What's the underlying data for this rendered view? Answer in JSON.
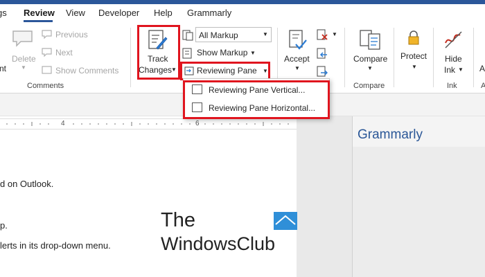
{
  "tabs": [
    {
      "label": "gs"
    },
    {
      "label": "Review"
    },
    {
      "label": "View"
    },
    {
      "label": "Developer"
    },
    {
      "label": "Help"
    },
    {
      "label": "Grammarly"
    }
  ],
  "comments_group": {
    "label": "Comments",
    "new_comment_fragment": "nt",
    "delete": "Delete",
    "previous": "Previous",
    "next": "Next",
    "show_comments": "Show Comments"
  },
  "tracking_group": {
    "track_changes_line1": "Track",
    "track_changes_line2": "Changes",
    "markup_select": "All Markup",
    "show_markup": "Show Markup",
    "reviewing_pane": "Reviewing Pane"
  },
  "changes_group": {
    "accept": "Accept"
  },
  "compare_group": {
    "compare": "Compare",
    "label": "Compare"
  },
  "protect_group": {
    "protect": "Protect"
  },
  "ink_group": {
    "hide_ink_line1": "Hide",
    "hide_ink_line2": "Ink",
    "label": "Ink",
    "cut_fragment_a": "A",
    "cut_fragment_b": "A"
  },
  "reviewing_pane_menu": [
    {
      "label": "Reviewing Pane Vertical..."
    },
    {
      "label": "Reviewing Pane Horizontal..."
    }
  ],
  "ruler": {
    "marks": [
      "4",
      "6"
    ]
  },
  "document": {
    "lines": [
      "d on Outlook.",
      "p.",
      "lerts in its drop-down menu."
    ]
  },
  "grammarly": {
    "title": "Grammarly"
  },
  "watermark": {
    "line1": "The",
    "line2": "WindowsClub"
  },
  "colors": {
    "accent": "#2b579a",
    "highlight": "#e0141e",
    "grammarly": "#2b5797"
  }
}
